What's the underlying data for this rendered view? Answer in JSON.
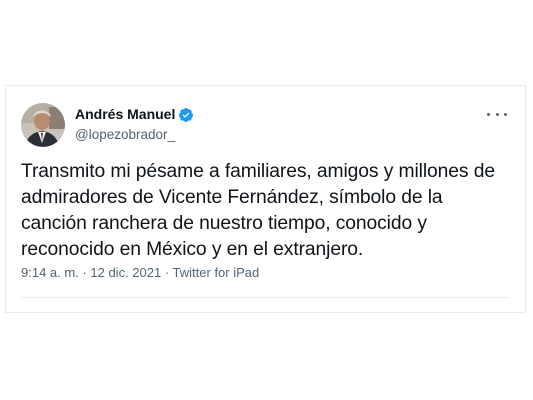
{
  "tweet": {
    "author": {
      "name": "Andrés Manuel",
      "handle": "@lopezobrador_",
      "verified": true,
      "verified_color": "#1d9bf0",
      "avatar_icon": "profile-photo"
    },
    "more_icon": "ellipsis-icon",
    "text": "Transmito mi pésame a familiares, amigos y millones de admiradores de Vicente Fernández, símbolo de la canción ranchera de nuestro tiempo, conocido y reconocido en México y en el extranjero.",
    "time": "9:14 a. m.",
    "separator": " · ",
    "date": "12 dic. 2021",
    "source": "Twitter for iPad"
  }
}
